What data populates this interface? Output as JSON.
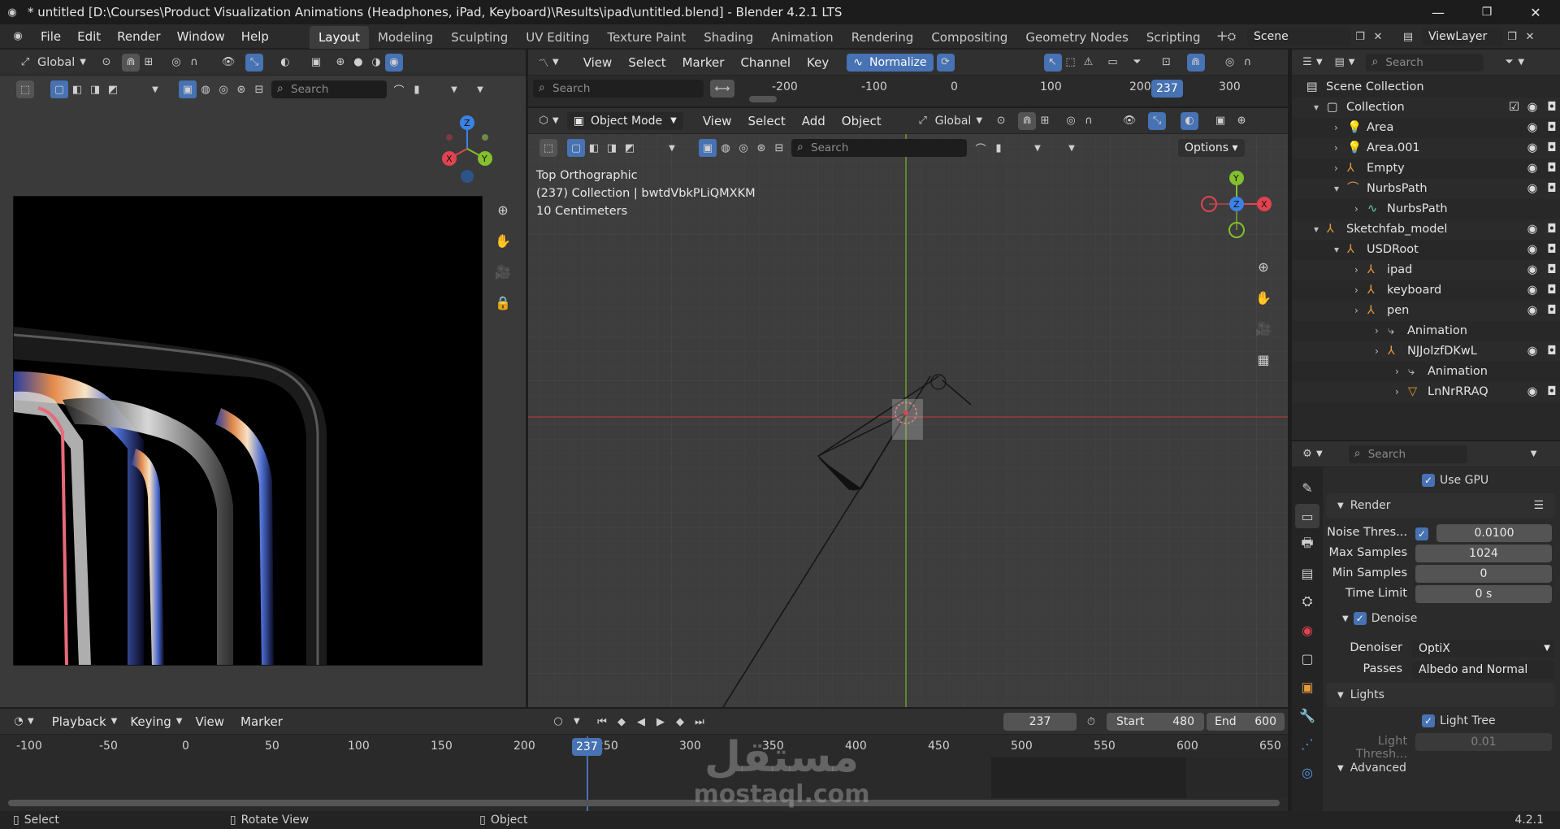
{
  "window": {
    "title": "* untitled [D:\\Courses\\Product Visualization Animations (Headphones, iPad, Keyboard)\\Results\\ipad\\untitled.blend] - Blender 4.2.1 LTS"
  },
  "menu": [
    "File",
    "Edit",
    "Render",
    "Window",
    "Help"
  ],
  "workspaces": [
    "Layout",
    "Modeling",
    "Sculpting",
    "UV Editing",
    "Texture Paint",
    "Shading",
    "Animation",
    "Rendering",
    "Compositing",
    "Geometry Nodes",
    "Scripting"
  ],
  "scene": {
    "label": "Scene",
    "viewlayer": "ViewLayer"
  },
  "left_view": {
    "orientation": "Global",
    "search_placeholder": "Search"
  },
  "graph_editor": {
    "menus": [
      "View",
      "Select",
      "Marker",
      "Channel",
      "Key"
    ],
    "normalize": "Normalize",
    "search_placeholder": "Search",
    "ruler": [
      "-200",
      "-100",
      "0",
      "100",
      "200",
      "300"
    ],
    "frame": "237"
  },
  "viewport": {
    "mode": "Object Mode",
    "menus": [
      "View",
      "Select",
      "Add",
      "Object"
    ],
    "orientation": "Global",
    "search_placeholder": "Search",
    "options": "Options",
    "overlay_lines": [
      "Top Orthographic",
      "(237) Collection | bwtdVbkPLiQMXKM",
      "10 Centimeters"
    ]
  },
  "outliner": {
    "search_placeholder": "Search",
    "rows": [
      {
        "label": "Scene Collection",
        "indent": 0,
        "icon": "scene-collection-icon"
      },
      {
        "label": "Collection",
        "indent": 1,
        "icon": "collection-icon"
      },
      {
        "label": "Area",
        "indent": 2,
        "icon": "light-icon"
      },
      {
        "label": "Area.001",
        "indent": 2,
        "icon": "light-icon"
      },
      {
        "label": "Empty",
        "indent": 2,
        "icon": "empty-icon"
      },
      {
        "label": "NurbsPath",
        "indent": 2,
        "icon": "curve-icon"
      },
      {
        "label": "NurbsPath",
        "indent": 3,
        "icon": "curve-data-icon"
      },
      {
        "label": "Sketchfab_model",
        "indent": 1,
        "icon": "empty-icon"
      },
      {
        "label": "USDRoot",
        "indent": 2,
        "icon": "empty-icon"
      },
      {
        "label": "ipad",
        "indent": 3,
        "icon": "empty-icon"
      },
      {
        "label": "keyboard",
        "indent": 3,
        "icon": "empty-icon"
      },
      {
        "label": "pen",
        "indent": 3,
        "icon": "empty-icon"
      },
      {
        "label": "Animation",
        "indent": 4,
        "icon": "action-icon"
      },
      {
        "label": "NJJoIzfDKwL",
        "indent": 4,
        "icon": "empty-icon"
      },
      {
        "label": "Animation",
        "indent": 5,
        "icon": "action-icon"
      },
      {
        "label": "LnNrRRAQ",
        "indent": 5,
        "icon": "mesh-icon"
      }
    ]
  },
  "properties": {
    "search_placeholder": "Search",
    "use_gpu": "Use GPU",
    "render_section": "Render",
    "noise_threshold": {
      "label": "Noise Thres...",
      "value": "0.0100"
    },
    "max_samples": {
      "label": "Max Samples",
      "value": "1024"
    },
    "min_samples": {
      "label": "Min Samples",
      "value": "0"
    },
    "time_limit": {
      "label": "Time Limit",
      "value": "0 s"
    },
    "denoise": "Denoise",
    "denoiser": {
      "label": "Denoiser",
      "value": "OptiX"
    },
    "passes": {
      "label": "Passes",
      "value": "Albedo and Normal"
    },
    "lights_section": "Lights",
    "light_tree": "Light Tree",
    "light_threshold": {
      "label": "Light Thresh...",
      "value": "0.01"
    },
    "advanced": "Advanced"
  },
  "timeline": {
    "menus": [
      "Playback",
      "Keying",
      "View",
      "Marker"
    ],
    "current": "237",
    "start_label": "Start",
    "start": "480",
    "end_label": "End",
    "end": "600",
    "ruler": [
      "-100",
      "-50",
      "0",
      "50",
      "100",
      "150",
      "200",
      "250",
      "300",
      "350",
      "400",
      "450",
      "500",
      "550",
      "600",
      "650"
    ]
  },
  "statusbar": {
    "select": "Select",
    "rotate": "Rotate View",
    "object": "Object",
    "version": "4.2.1"
  },
  "watermark": {
    "arabic": "مستقل",
    "latin": "mostaql.com"
  },
  "colors": {
    "accent": "#4772b3",
    "x_axis": "#e0434f",
    "y_axis": "#83c02c",
    "z_axis": "#3b82e6"
  }
}
